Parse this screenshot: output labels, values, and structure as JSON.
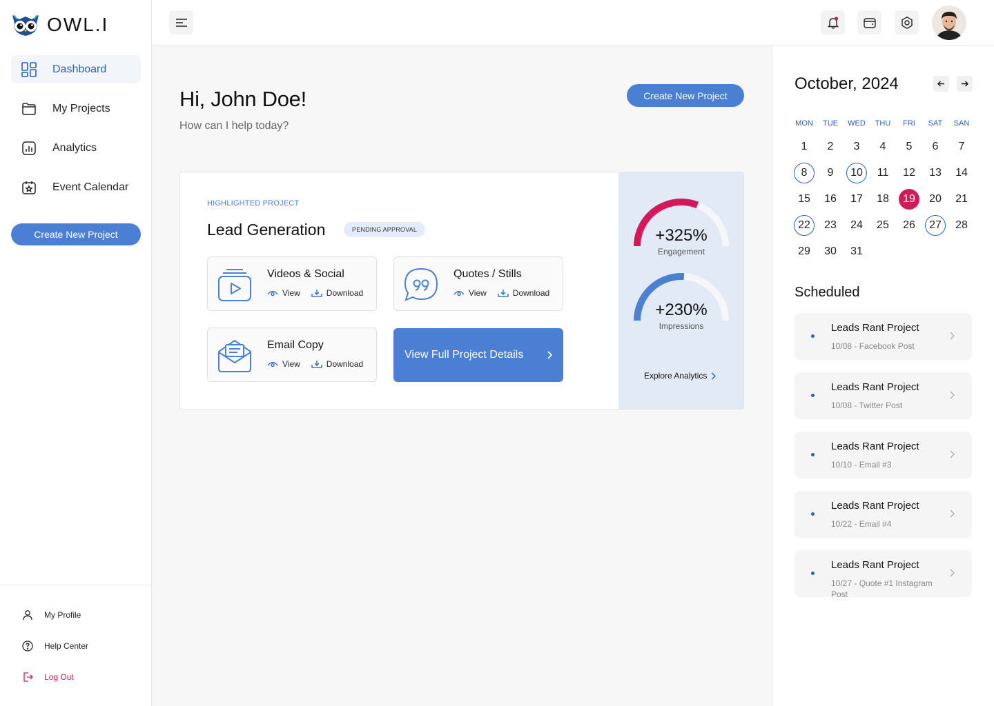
{
  "brand": {
    "name": "OWL.I"
  },
  "sidebar": {
    "items": [
      {
        "label": "Dashboard",
        "icon": "dashboard-icon",
        "active": true
      },
      {
        "label": "My Projects",
        "icon": "folder-icon"
      },
      {
        "label": "Analytics",
        "icon": "analytics-icon"
      },
      {
        "label": "Event Calendar",
        "icon": "calendar-star-icon"
      }
    ],
    "create_label": "Create New Project",
    "bottom": [
      {
        "label": "My Profile",
        "icon": "user-icon"
      },
      {
        "label": "Help Center",
        "icon": "help-icon"
      },
      {
        "label": "Log Out",
        "icon": "logout-icon"
      }
    ]
  },
  "header": {
    "icons": [
      "menu-icon",
      "bell-icon",
      "wallet-icon",
      "settings-icon"
    ]
  },
  "main": {
    "greeting": "Hi, John Doe!",
    "subtitle": "How can I help today?",
    "create_label": "Create New Project",
    "highlight": {
      "label": "HIGHLIGHTED PROJECT",
      "title": "Lead Generation",
      "badge": "PENDING APPROVAL",
      "tiles": [
        {
          "name": "Videos & Social",
          "view": "View",
          "download": "Download",
          "icon": "video-social-icon"
        },
        {
          "name": "Quotes / Stills",
          "view": "View",
          "download": "Download",
          "icon": "quote-bubble-icon"
        },
        {
          "name": "Email Copy",
          "view": "View",
          "download": "Download",
          "icon": "email-icon"
        }
      ],
      "details_label": "View Full Project Details"
    },
    "stats": [
      {
        "value": "+325%",
        "label": "Engagement",
        "fill": 0.62,
        "color": "#d21a5a"
      },
      {
        "value": "+230%",
        "label": "Impressions",
        "fill": 0.52,
        "color": "#4a7fd4"
      }
    ],
    "explore_label": "Explore Analytics"
  },
  "calendar": {
    "month": "October, 2024",
    "weekdays": [
      "MON",
      "TUE",
      "WED",
      "THU",
      "FRI",
      "SAT",
      "SAN"
    ],
    "weeks": [
      [
        "1",
        "2",
        "3",
        "4",
        "5",
        "6",
        "7"
      ],
      [
        "8",
        "9",
        "10",
        "11",
        "12",
        "13",
        "14"
      ],
      [
        "15",
        "16",
        "17",
        "18",
        "19",
        "20",
        "21"
      ],
      [
        "22",
        "23",
        "24",
        "25",
        "26",
        "27",
        "28"
      ],
      [
        "29",
        "30",
        "31",
        "",
        "",
        "",
        ""
      ]
    ],
    "ringed": [
      "8",
      "10",
      "22",
      "27"
    ],
    "today": "19",
    "today_color": "#d21a5a",
    "ring_color": "#2b5fb8"
  },
  "scheduled": {
    "title": "Scheduled",
    "items": [
      {
        "title": "Leads Rant Project",
        "sub": "10/08 - Facebook Post"
      },
      {
        "title": "Leads Rant Project",
        "sub": "10/08 - Twitter Post"
      },
      {
        "title": "Leads Rant Project",
        "sub": "10/10 - Email #3"
      },
      {
        "title": "Leads Rant Project",
        "sub": "10/22 - Email #4"
      },
      {
        "title": "Leads Rant Project",
        "sub": "10/27 -  Quote #1 Instagram Post"
      }
    ]
  },
  "colors": {
    "accent": "#4a7fd4",
    "accent_dark": "#2b5fb8",
    "pink": "#d21a5a"
  }
}
